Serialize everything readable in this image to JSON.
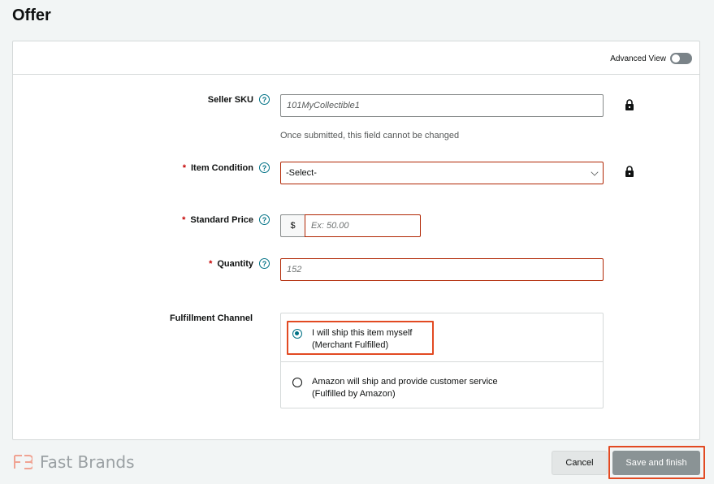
{
  "page": {
    "title": "Offer"
  },
  "header": {
    "advanced_view_label": "Advanced View",
    "advanced_view_on": false
  },
  "fields": {
    "seller_sku": {
      "label": "Seller SKU",
      "value": "101MyCollectible1",
      "hint": "Once submitted, this field cannot be changed",
      "required": false
    },
    "item_condition": {
      "label": "Item Condition",
      "required_mark": "*",
      "selected": "-Select-"
    },
    "standard_price": {
      "label": "Standard Price",
      "required_mark": "*",
      "currency": "$",
      "placeholder": "Ex: 50.00"
    },
    "quantity": {
      "label": "Quantity",
      "required_mark": "*",
      "placeholder": "152"
    },
    "fulfillment": {
      "label": "Fulfillment Channel",
      "options": [
        {
          "line1": "I will ship this item myself",
          "line2": "(Merchant Fulfilled)",
          "checked": true
        },
        {
          "line1": "Amazon will ship and provide customer service",
          "line2": "(Fulfilled by Amazon)",
          "checked": false
        }
      ]
    }
  },
  "icons": {
    "help": "?",
    "lock": "lock-icon"
  },
  "footer": {
    "brand": "Fast Brands",
    "cancel_label": "Cancel",
    "save_label": "Save and finish"
  },
  "colors": {
    "accent": "#007185",
    "error_border": "#b12704",
    "highlight": "#e24a22",
    "brand_logo": "#f0a393"
  }
}
